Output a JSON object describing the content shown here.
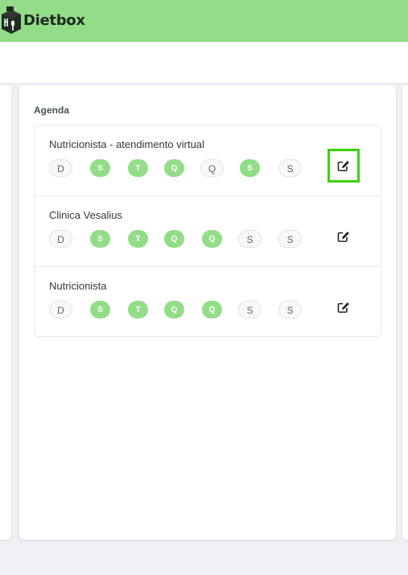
{
  "app": {
    "brand": "Dietbox",
    "accent": "#93dd88",
    "focus_outline": "#3bd20f"
  },
  "agenda": {
    "title": "Agenda",
    "items": [
      {
        "name": "Nutricionista - atendimento virtual",
        "days": [
          {
            "label": "D",
            "active": false
          },
          {
            "label": "S",
            "active": true
          },
          {
            "label": "T",
            "active": true
          },
          {
            "label": "Q",
            "active": true
          },
          {
            "label": "Q",
            "active": false
          },
          {
            "label": "S",
            "active": true
          },
          {
            "label": "S",
            "active": false
          }
        ],
        "edit_icon": "edit-icon",
        "focused": true
      },
      {
        "name": "Clinica Vesalius",
        "days": [
          {
            "label": "D",
            "active": false
          },
          {
            "label": "S",
            "active": true
          },
          {
            "label": "T",
            "active": true
          },
          {
            "label": "Q",
            "active": true
          },
          {
            "label": "Q",
            "active": true
          },
          {
            "label": "S",
            "active": false
          },
          {
            "label": "S",
            "active": false
          }
        ],
        "edit_icon": "edit-icon",
        "focused": false
      },
      {
        "name": "Nutricionista",
        "days": [
          {
            "label": "D",
            "active": false
          },
          {
            "label": "S",
            "active": true
          },
          {
            "label": "T",
            "active": true
          },
          {
            "label": "Q",
            "active": true
          },
          {
            "label": "Q",
            "active": true
          },
          {
            "label": "S",
            "active": false
          },
          {
            "label": "S",
            "active": false
          }
        ],
        "edit_icon": "edit-icon",
        "focused": false
      }
    ]
  }
}
